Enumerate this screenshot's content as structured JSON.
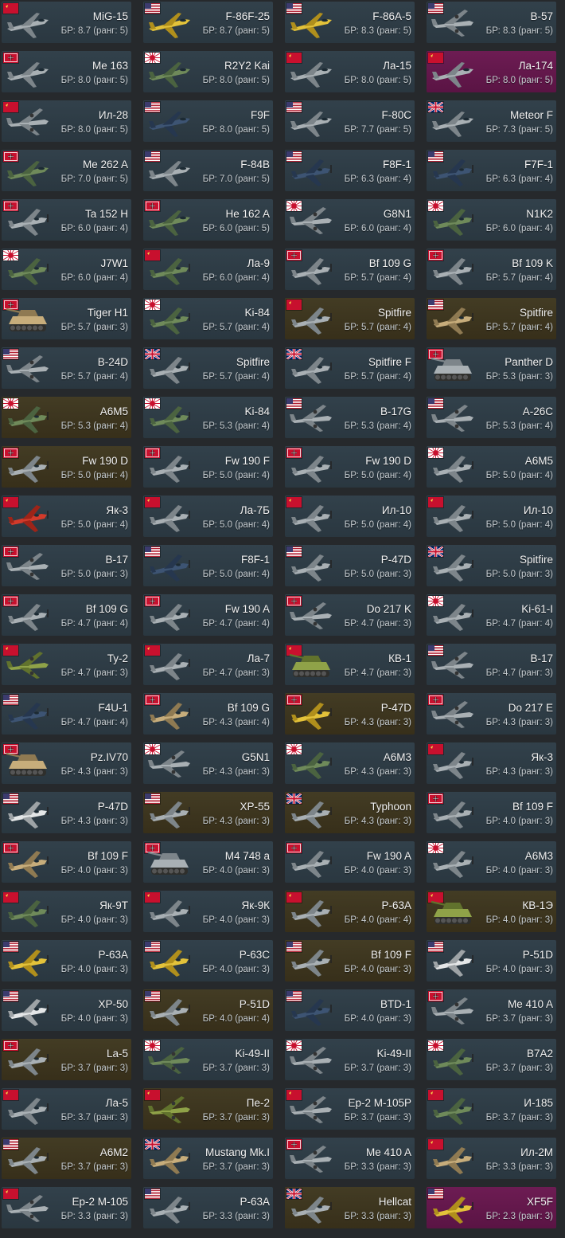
{
  "palette": {
    "standard": "#32414b",
    "premium": "#433c24",
    "event": "#6d1c53",
    "text": "#f2f2f2",
    "subtext": "#c7cdd1"
  },
  "vehicles": [
    {
      "name": "MiG-15",
      "br": "БР: 8.7 (ранг: 5)",
      "nation": "ussr",
      "kind": "jet",
      "style": "std"
    },
    {
      "name": "F-86F-25",
      "br": "БР: 8.7 (ранг: 5)",
      "nation": "usa",
      "kind": "jet",
      "style": "std",
      "paint": "yellow"
    },
    {
      "name": "F-86A-5",
      "br": "БР: 8.3 (ранг: 5)",
      "nation": "usa",
      "kind": "jet",
      "style": "std",
      "paint": "yellow"
    },
    {
      "name": "B-57",
      "br": "БР: 8.3 (ранг: 5)",
      "nation": "usa",
      "kind": "bomber",
      "style": "std"
    },
    {
      "name": "Me 163",
      "br": "БР: 8.0 (ранг: 5)",
      "nation": "germany",
      "kind": "jet",
      "style": "std"
    },
    {
      "name": "R2Y2 Kai",
      "br": "БР: 8.0 (ранг: 5)",
      "nation": "japan",
      "kind": "jet",
      "style": "std",
      "paint": "green"
    },
    {
      "name": "Ла-15",
      "br": "БР: 8.0 (ранг: 5)",
      "nation": "ussr",
      "kind": "jet",
      "style": "std"
    },
    {
      "name": "Ла-174",
      "br": "БР: 8.0 (ранг: 5)",
      "nation": "ussr",
      "kind": "jet",
      "style": "event"
    },
    {
      "name": "Ил-28",
      "br": "БР: 8.0 (ранг: 5)",
      "nation": "ussr",
      "kind": "bomber",
      "style": "std"
    },
    {
      "name": "F9F",
      "br": "БР: 8.0 (ранг: 5)",
      "nation": "usa",
      "kind": "jet",
      "style": "std",
      "paint": "navy"
    },
    {
      "name": "F-80C",
      "br": "БР: 7.7 (ранг: 5)",
      "nation": "usa",
      "kind": "jet",
      "style": "std"
    },
    {
      "name": "Meteor F",
      "br": "БР: 7.3 (ранг: 5)",
      "nation": "uk",
      "kind": "jet",
      "style": "std"
    },
    {
      "name": "Me 262 A",
      "br": "БР: 7.0 (ранг: 5)",
      "nation": "germany",
      "kind": "jet",
      "style": "std",
      "paint": "green"
    },
    {
      "name": "F-84B",
      "br": "БР: 7.0 (ранг: 5)",
      "nation": "usa",
      "kind": "jet",
      "style": "std"
    },
    {
      "name": "F8F-1",
      "br": "БР: 6.3 (ранг: 4)",
      "nation": "usa",
      "kind": "prop",
      "style": "std",
      "paint": "navy"
    },
    {
      "name": "F7F-1",
      "br": "БР: 6.3 (ранг: 4)",
      "nation": "usa",
      "kind": "prop",
      "style": "std",
      "paint": "navy"
    },
    {
      "name": "Ta 152 H",
      "br": "БР: 6.0 (ранг: 4)",
      "nation": "germany",
      "kind": "prop",
      "style": "std"
    },
    {
      "name": "He 162 A",
      "br": "БР: 6.0 (ранг: 5)",
      "nation": "germany",
      "kind": "jet",
      "style": "std",
      "paint": "green"
    },
    {
      "name": "G8N1",
      "br": "БР: 6.0 (ранг: 4)",
      "nation": "japan",
      "kind": "bomber",
      "style": "std"
    },
    {
      "name": "N1K2",
      "br": "БР: 6.0 (ранг: 4)",
      "nation": "japan",
      "kind": "prop",
      "style": "std",
      "paint": "green"
    },
    {
      "name": "J7W1",
      "br": "БР: 6.0 (ранг: 4)",
      "nation": "japan",
      "kind": "prop",
      "style": "std",
      "paint": "green"
    },
    {
      "name": "Ла-9",
      "br": "БР: 6.0 (ранг: 4)",
      "nation": "ussr",
      "kind": "prop",
      "style": "std",
      "paint": "green"
    },
    {
      "name": "Bf 109 G",
      "br": "БР: 5.7 (ранг: 4)",
      "nation": "germany",
      "kind": "prop",
      "style": "std"
    },
    {
      "name": "Bf 109 K",
      "br": "БР: 5.7 (ранг: 4)",
      "nation": "germany",
      "kind": "prop",
      "style": "std"
    },
    {
      "name": "Tiger H1",
      "br": "БР: 5.7 (ранг: 3)",
      "nation": "germany",
      "kind": "tank",
      "style": "std",
      "paint": "sand"
    },
    {
      "name": "Ki-84",
      "br": "БР: 5.7 (ранг: 4)",
      "nation": "japan",
      "kind": "prop",
      "style": "std",
      "paint": "green"
    },
    {
      "name": "Spitfire",
      "br": "БР: 5.7 (ранг: 4)",
      "nation": "ussr",
      "kind": "prop",
      "style": "prem"
    },
    {
      "name": "Spitfire",
      "br": "БР: 5.7 (ранг: 4)",
      "nation": "usa",
      "kind": "prop",
      "style": "prem",
      "paint": "sand"
    },
    {
      "name": "B-24D",
      "br": "БР: 5.7 (ранг: 4)",
      "nation": "usa",
      "kind": "bomber",
      "style": "std"
    },
    {
      "name": "Spitfire",
      "br": "БР: 5.7 (ранг: 4)",
      "nation": "uk",
      "kind": "prop",
      "style": "std"
    },
    {
      "name": "Spitfire F",
      "br": "БР: 5.7 (ранг: 4)",
      "nation": "uk",
      "kind": "prop",
      "style": "std"
    },
    {
      "name": "Panther D",
      "br": "БР: 5.3 (ранг: 3)",
      "nation": "germany",
      "kind": "tank",
      "style": "std"
    },
    {
      "name": "A6M5",
      "br": "БР: 5.3 (ранг: 4)",
      "nation": "japan",
      "kind": "prop",
      "style": "prem",
      "paint": "green"
    },
    {
      "name": "Ki-84",
      "br": "БР: 5.3 (ранг: 4)",
      "nation": "japan",
      "kind": "prop",
      "style": "std",
      "paint": "green"
    },
    {
      "name": "B-17G",
      "br": "БР: 5.3 (ранг: 4)",
      "nation": "usa",
      "kind": "bomber",
      "style": "std"
    },
    {
      "name": "A-26C",
      "br": "БР: 5.3 (ранг: 4)",
      "nation": "usa",
      "kind": "bomber",
      "style": "std"
    },
    {
      "name": "Fw 190 D",
      "br": "БР: 5.0 (ранг: 4)",
      "nation": "germany",
      "kind": "prop",
      "style": "prem"
    },
    {
      "name": "Fw 190 F",
      "br": "БР: 5.0 (ранг: 4)",
      "nation": "germany",
      "kind": "prop",
      "style": "std"
    },
    {
      "name": "Fw 190 D",
      "br": "БР: 5.0 (ранг: 4)",
      "nation": "germany",
      "kind": "prop",
      "style": "std"
    },
    {
      "name": "A6M5",
      "br": "БР: 5.0 (ранг: 4)",
      "nation": "japan",
      "kind": "prop",
      "style": "std"
    },
    {
      "name": "Як-3",
      "br": "БР: 5.0 (ранг: 4)",
      "nation": "ussr",
      "kind": "prop",
      "style": "std",
      "paint": "red"
    },
    {
      "name": "Ла-7Б",
      "br": "БР: 5.0 (ранг: 4)",
      "nation": "ussr",
      "kind": "prop",
      "style": "std"
    },
    {
      "name": "Ил-10",
      "br": "БР: 5.0 (ранг: 4)",
      "nation": "ussr",
      "kind": "prop",
      "style": "std"
    },
    {
      "name": "Ил-10",
      "br": "БР: 5.0 (ранг: 4)",
      "nation": "ussr",
      "kind": "prop",
      "style": "std"
    },
    {
      "name": "B-17",
      "br": "БР: 5.0 (ранг: 3)",
      "nation": "germany",
      "kind": "bomber",
      "style": "std"
    },
    {
      "name": "F8F-1",
      "br": "БР: 5.0 (ранг: 4)",
      "nation": "usa",
      "kind": "prop",
      "style": "std",
      "paint": "navy"
    },
    {
      "name": "P-47D",
      "br": "БР: 5.0 (ранг: 3)",
      "nation": "usa",
      "kind": "prop",
      "style": "std"
    },
    {
      "name": "Spitfire",
      "br": "БР: 5.0 (ранг: 3)",
      "nation": "uk",
      "kind": "prop",
      "style": "std"
    },
    {
      "name": "Bf 109 G",
      "br": "БР: 4.7 (ранг: 4)",
      "nation": "germany",
      "kind": "prop",
      "style": "std"
    },
    {
      "name": "Fw 190 A",
      "br": "БР: 4.7 (ранг: 4)",
      "nation": "germany",
      "kind": "prop",
      "style": "std"
    },
    {
      "name": "Do 217 K",
      "br": "БР: 4.7 (ранг: 3)",
      "nation": "germany",
      "kind": "bomber",
      "style": "std"
    },
    {
      "name": "Ki-61-I",
      "br": "БР: 4.7 (ранг: 4)",
      "nation": "japan",
      "kind": "prop",
      "style": "std"
    },
    {
      "name": "Ту-2",
      "br": "БР: 4.7 (ранг: 3)",
      "nation": "ussr",
      "kind": "bomber",
      "style": "std",
      "paint": "olive"
    },
    {
      "name": "Ла-7",
      "br": "БР: 4.7 (ранг: 3)",
      "nation": "ussr",
      "kind": "prop",
      "style": "std"
    },
    {
      "name": "КВ-1",
      "br": "БР: 4.7 (ранг: 3)",
      "nation": "ussr",
      "kind": "tank",
      "style": "std",
      "paint": "olive"
    },
    {
      "name": "B-17",
      "br": "БР: 4.7 (ранг: 3)",
      "nation": "usa",
      "kind": "bomber",
      "style": "std"
    },
    {
      "name": "F4U-1",
      "br": "БР: 4.7 (ранг: 4)",
      "nation": "usa",
      "kind": "prop",
      "style": "std",
      "paint": "navy"
    },
    {
      "name": "Bf 109 G",
      "br": "БР: 4.3 (ранг: 4)",
      "nation": "germany",
      "kind": "prop",
      "style": "std",
      "paint": "sand"
    },
    {
      "name": "P-47D",
      "br": "БР: 4.3 (ранг: 3)",
      "nation": "germany",
      "kind": "prop",
      "style": "prem",
      "paint": "yellow"
    },
    {
      "name": "Do 217 E",
      "br": "БР: 4.3 (ранг: 3)",
      "nation": "germany",
      "kind": "bomber",
      "style": "std"
    },
    {
      "name": "Pz.IV70",
      "br": "БР: 4.3 (ранг: 3)",
      "nation": "germany",
      "kind": "tank",
      "style": "std",
      "paint": "sand"
    },
    {
      "name": "G5N1",
      "br": "БР: 4.3 (ранг: 3)",
      "nation": "japan",
      "kind": "bomber",
      "style": "std"
    },
    {
      "name": "A6M3",
      "br": "БР: 4.3 (ранг: 3)",
      "nation": "japan",
      "kind": "prop",
      "style": "std",
      "paint": "green"
    },
    {
      "name": "Як-3",
      "br": "БР: 4.3 (ранг: 3)",
      "nation": "ussr",
      "kind": "prop",
      "style": "std"
    },
    {
      "name": "P-47D",
      "br": "БР: 4.3 (ранг: 3)",
      "nation": "usa",
      "kind": "prop",
      "style": "std",
      "paint": "white"
    },
    {
      "name": "XP-55",
      "br": "БР: 4.3 (ранг: 3)",
      "nation": "usa",
      "kind": "prop",
      "style": "prem"
    },
    {
      "name": "Typhoon",
      "br": "БР: 4.3 (ранг: 3)",
      "nation": "uk",
      "kind": "prop",
      "style": "prem"
    },
    {
      "name": "Bf 109 F",
      "br": "БР: 4.0 (ранг: 3)",
      "nation": "germany",
      "kind": "prop",
      "style": "std"
    },
    {
      "name": "Bf 109 F",
      "br": "БР: 4.0 (ранг: 3)",
      "nation": "germany",
      "kind": "prop",
      "style": "std",
      "paint": "sand"
    },
    {
      "name": "M4 748 a",
      "br": "БР: 4.0 (ранг: 3)",
      "nation": "germany",
      "kind": "tank",
      "style": "std"
    },
    {
      "name": "Fw 190 A",
      "br": "БР: 4.0 (ранг: 3)",
      "nation": "germany",
      "kind": "prop",
      "style": "std"
    },
    {
      "name": "A6M3",
      "br": "БР: 4.0 (ранг: 3)",
      "nation": "japan",
      "kind": "prop",
      "style": "std"
    },
    {
      "name": "Як-9Т",
      "br": "БР: 4.0 (ранг: 3)",
      "nation": "ussr",
      "kind": "prop",
      "style": "std",
      "paint": "green"
    },
    {
      "name": "Як-9К",
      "br": "БР: 4.0 (ранг: 3)",
      "nation": "ussr",
      "kind": "prop",
      "style": "std"
    },
    {
      "name": "P-63A",
      "br": "БР: 4.0 (ранг: 4)",
      "nation": "ussr",
      "kind": "prop",
      "style": "prem"
    },
    {
      "name": "КВ-1Э",
      "br": "БР: 4.0 (ранг: 3)",
      "nation": "ussr",
      "kind": "tank",
      "style": "prem",
      "paint": "olive"
    },
    {
      "name": "P-63A",
      "br": "БР: 4.0 (ранг: 3)",
      "nation": "usa",
      "kind": "prop",
      "style": "std",
      "paint": "yellow"
    },
    {
      "name": "P-63C",
      "br": "БР: 4.0 (ранг: 3)",
      "nation": "usa",
      "kind": "prop",
      "style": "std",
      "paint": "yellow"
    },
    {
      "name": "Bf 109 F",
      "br": "БР: 4.0 (ранг: 3)",
      "nation": "usa",
      "kind": "prop",
      "style": "prem"
    },
    {
      "name": "P-51D",
      "br": "БР: 4.0 (ранг: 3)",
      "nation": "usa",
      "kind": "prop",
      "style": "std",
      "paint": "white"
    },
    {
      "name": "XP-50",
      "br": "БР: 4.0 (ранг: 3)",
      "nation": "usa",
      "kind": "prop",
      "style": "std",
      "paint": "white"
    },
    {
      "name": "P-51D",
      "br": "БР: 4.0 (ранг: 4)",
      "nation": "usa",
      "kind": "prop",
      "style": "prem"
    },
    {
      "name": "BTD-1",
      "br": "БР: 4.0 (ранг: 3)",
      "nation": "usa",
      "kind": "prop",
      "style": "std",
      "paint": "navy"
    },
    {
      "name": "Me 410 A",
      "br": "БР: 3.7 (ранг: 3)",
      "nation": "germany",
      "kind": "bomber",
      "style": "std"
    },
    {
      "name": "La-5",
      "br": "БР: 3.7 (ранг: 3)",
      "nation": "germany",
      "kind": "prop",
      "style": "prem"
    },
    {
      "name": "Ki-49-II",
      "br": "БР: 3.7 (ранг: 3)",
      "nation": "japan",
      "kind": "bomber",
      "style": "std",
      "paint": "green"
    },
    {
      "name": "Ki-49-II",
      "br": "БР: 3.7 (ранг: 3)",
      "nation": "japan",
      "kind": "bomber",
      "style": "std"
    },
    {
      "name": "B7A2",
      "br": "БР: 3.7 (ранг: 3)",
      "nation": "japan",
      "kind": "prop",
      "style": "std",
      "paint": "green"
    },
    {
      "name": "Ла-5",
      "br": "БР: 3.7 (ранг: 3)",
      "nation": "ussr",
      "kind": "prop",
      "style": "std"
    },
    {
      "name": "Пе-2",
      "br": "БР: 3.7 (ранг: 3)",
      "nation": "ussr",
      "kind": "bomber",
      "style": "prem",
      "paint": "olive"
    },
    {
      "name": "Ер-2 М-105Р",
      "br": "БР: 3.7 (ранг: 3)",
      "nation": "ussr",
      "kind": "bomber",
      "style": "std"
    },
    {
      "name": "И-185",
      "br": "БР: 3.7 (ранг: 3)",
      "nation": "ussr",
      "kind": "prop",
      "style": "std",
      "paint": "green"
    },
    {
      "name": "A6M2",
      "br": "БР: 3.7 (ранг: 3)",
      "nation": "usa",
      "kind": "prop",
      "style": "prem"
    },
    {
      "name": "Mustang Mk.I",
      "br": "БР: 3.7 (ранг: 3)",
      "nation": "uk",
      "kind": "prop",
      "style": "std",
      "paint": "sand"
    },
    {
      "name": "Me 410 A",
      "br": "БР: 3.3 (ранг: 3)",
      "nation": "germany",
      "kind": "bomber",
      "style": "std"
    },
    {
      "name": "Ил-2М",
      "br": "БР: 3.3 (ранг: 3)",
      "nation": "ussr",
      "kind": "prop",
      "style": "std",
      "paint": "sand"
    },
    {
      "name": "Ер-2 М-105",
      "br": "БР: 3.3 (ранг: 3)",
      "nation": "ussr",
      "kind": "bomber",
      "style": "std"
    },
    {
      "name": "P-63A",
      "br": "БР: 3.3 (ранг: 3)",
      "nation": "usa",
      "kind": "prop",
      "style": "std"
    },
    {
      "name": "Hellcat",
      "br": "БР: 3.3 (ранг: 3)",
      "nation": "uk",
      "kind": "prop",
      "style": "prem"
    },
    {
      "name": "XF5F",
      "br": "БР: 2.3 (ранг: 3)",
      "nation": "usa",
      "kind": "prop",
      "style": "event",
      "paint": "yellow"
    }
  ]
}
